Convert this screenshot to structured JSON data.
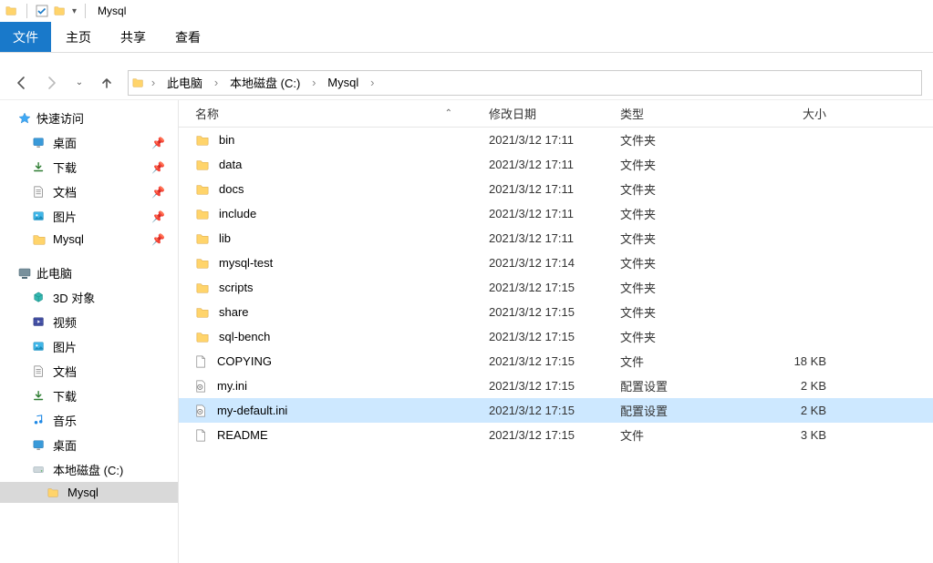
{
  "titlebar": {
    "title": "Mysql"
  },
  "ribbon": {
    "file": "文件",
    "tabs": [
      "主页",
      "共享",
      "查看"
    ]
  },
  "breadcrumb": [
    "此电脑",
    "本地磁盘 (C:)",
    "Mysql"
  ],
  "columns": {
    "name": "名称",
    "date": "修改日期",
    "type": "类型",
    "size": "大小"
  },
  "sidebar": {
    "quick_access": {
      "label": "快速访问",
      "items": [
        {
          "icon": "desktop",
          "label": "桌面",
          "pinned": true
        },
        {
          "icon": "download",
          "label": "下载",
          "pinned": true
        },
        {
          "icon": "document",
          "label": "文档",
          "pinned": true
        },
        {
          "icon": "pictures",
          "label": "图片",
          "pinned": true
        },
        {
          "icon": "folder",
          "label": "Mysql",
          "pinned": true
        }
      ]
    },
    "this_pc": {
      "label": "此电脑",
      "items": [
        {
          "icon": "3d",
          "label": "3D 对象"
        },
        {
          "icon": "video",
          "label": "视频"
        },
        {
          "icon": "pictures",
          "label": "图片"
        },
        {
          "icon": "document",
          "label": "文档"
        },
        {
          "icon": "download",
          "label": "下载"
        },
        {
          "icon": "music",
          "label": "音乐"
        },
        {
          "icon": "desktop",
          "label": "桌面"
        },
        {
          "icon": "drive",
          "label": "本地磁盘 (C:)"
        }
      ]
    },
    "selected": {
      "icon": "folder",
      "label": "Mysql"
    }
  },
  "files": [
    {
      "icon": "folder",
      "name": "bin",
      "date": "2021/3/12 17:11",
      "type": "文件夹",
      "size": ""
    },
    {
      "icon": "folder",
      "name": "data",
      "date": "2021/3/12 17:11",
      "type": "文件夹",
      "size": ""
    },
    {
      "icon": "folder",
      "name": "docs",
      "date": "2021/3/12 17:11",
      "type": "文件夹",
      "size": ""
    },
    {
      "icon": "folder",
      "name": "include",
      "date": "2021/3/12 17:11",
      "type": "文件夹",
      "size": ""
    },
    {
      "icon": "folder",
      "name": "lib",
      "date": "2021/3/12 17:11",
      "type": "文件夹",
      "size": ""
    },
    {
      "icon": "folder",
      "name": "mysql-test",
      "date": "2021/3/12 17:14",
      "type": "文件夹",
      "size": ""
    },
    {
      "icon": "folder",
      "name": "scripts",
      "date": "2021/3/12 17:15",
      "type": "文件夹",
      "size": ""
    },
    {
      "icon": "folder",
      "name": "share",
      "date": "2021/3/12 17:15",
      "type": "文件夹",
      "size": ""
    },
    {
      "icon": "folder",
      "name": "sql-bench",
      "date": "2021/3/12 17:15",
      "type": "文件夹",
      "size": ""
    },
    {
      "icon": "file",
      "name": "COPYING",
      "date": "2021/3/12 17:15",
      "type": "文件",
      "size": "18 KB"
    },
    {
      "icon": "ini",
      "name": "my.ini",
      "date": "2021/3/12 17:15",
      "type": "配置设置",
      "size": "2 KB"
    },
    {
      "icon": "ini",
      "name": "my-default.ini",
      "date": "2021/3/12 17:15",
      "type": "配置设置",
      "size": "2 KB",
      "selected": true
    },
    {
      "icon": "file",
      "name": "README",
      "date": "2021/3/12 17:15",
      "type": "文件",
      "size": "3 KB"
    }
  ]
}
